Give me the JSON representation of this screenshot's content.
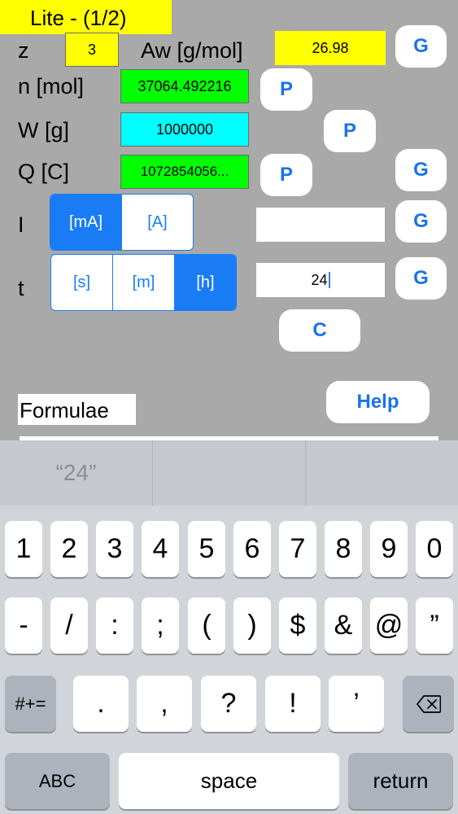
{
  "header": {
    "title": "Lite - (1/2)"
  },
  "rows": {
    "z": {
      "label": "z",
      "value": "3"
    },
    "aw": {
      "label": "Aw [g/mol]",
      "value": "26.98",
      "button": "G"
    },
    "n": {
      "label": "n  [mol]",
      "value": "37064.492216",
      "button": "P"
    },
    "w": {
      "label": "W [g]",
      "value": "1000000",
      "button": "P"
    },
    "q": {
      "label": "Q [C]",
      "value": "1072854056...",
      "button": "P",
      "button2": "G"
    },
    "i": {
      "label": "I",
      "units": [
        "[mA]",
        "[A]"
      ],
      "selected": "[mA]",
      "value": "",
      "button": "G"
    },
    "t": {
      "label": "t",
      "units": [
        "[s]",
        "[m]",
        "[h]"
      ],
      "selected": "[h]",
      "value": "24",
      "button": "G"
    }
  },
  "buttons": {
    "clear": "C",
    "help": "Help"
  },
  "formulae": {
    "label": "Formulae"
  },
  "keyboard": {
    "suggestions": [
      "“24”",
      "",
      ""
    ],
    "row1": [
      "1",
      "2",
      "3",
      "4",
      "5",
      "6",
      "7",
      "8",
      "9",
      "0"
    ],
    "row2": [
      "-",
      "/",
      ":",
      ";",
      "(",
      ")",
      "$",
      "&",
      "@",
      "”"
    ],
    "row3": [
      ".",
      ",",
      "?",
      "!",
      "’"
    ],
    "symbols_key": "#+=",
    "backspace_icon": "backspace-icon",
    "abc_key": "ABC",
    "space_key": "space",
    "return_key": "return"
  },
  "colors": {
    "app_background": "#a9a9a9",
    "yellow": "#ffff00",
    "green": "#00ff00",
    "cyan": "#00ffff",
    "accent_blue": "#1a7cf5",
    "keyboard_background": "#d1d4d9"
  }
}
